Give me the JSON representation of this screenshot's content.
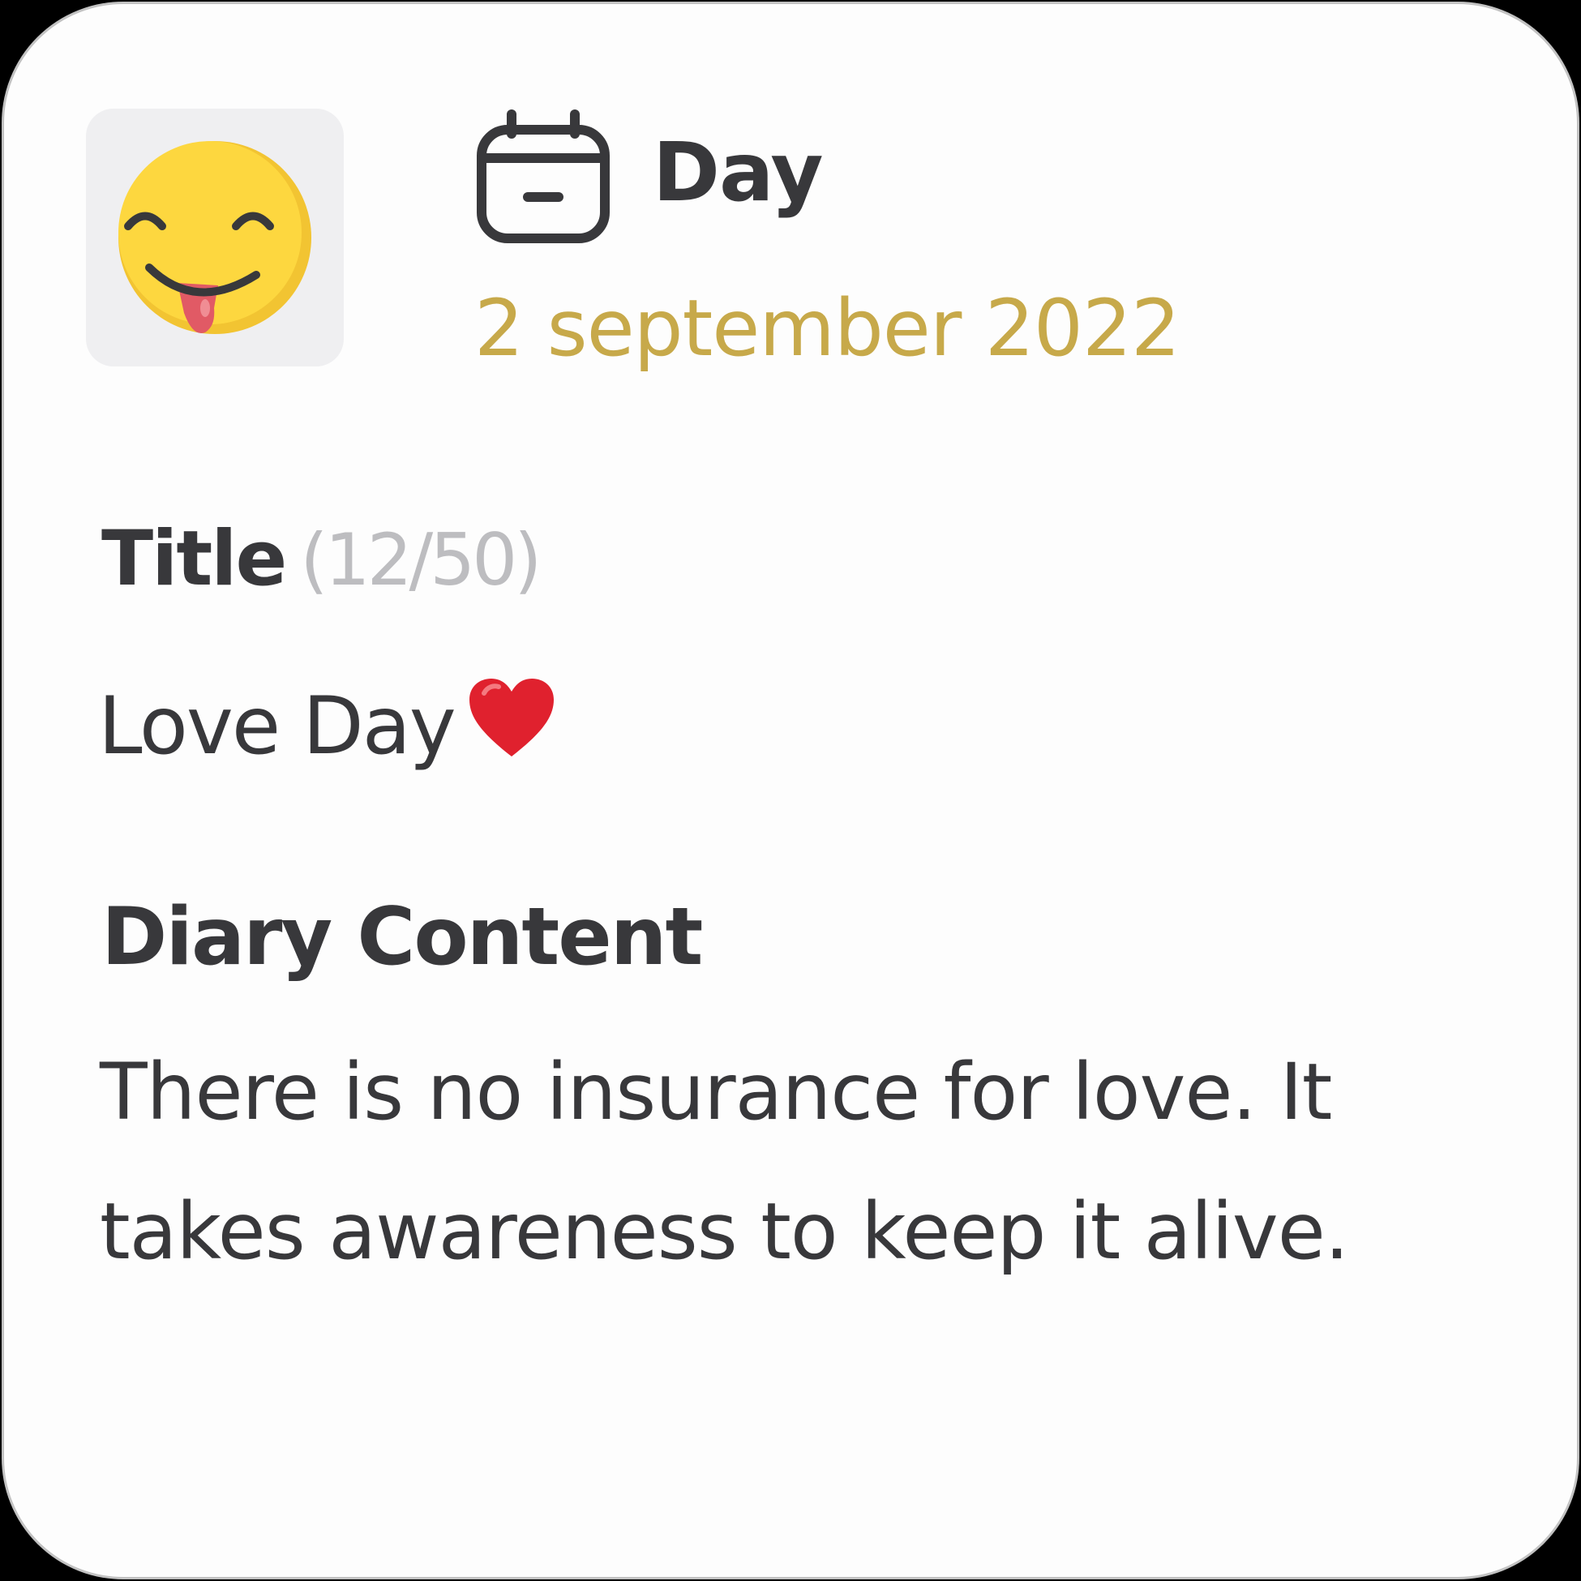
{
  "mood": {
    "icon": "tongue-out-smiley-icon"
  },
  "header": {
    "icon": "calendar-icon",
    "label": "Day",
    "date": "2 september 2022"
  },
  "title": {
    "label": "Title",
    "count": "(12/50)",
    "value": "Love Day",
    "emoji": "red-heart-icon"
  },
  "content": {
    "label": "Diary Content",
    "text": "There is no insurance for love. It takes awareness to keep it alive."
  },
  "colors": {
    "text": "#38383b",
    "accent": "#c7a94a",
    "muted": "#bdbdc0",
    "emoji_yellow": "#fdd73f",
    "heart": "#e0212e"
  }
}
